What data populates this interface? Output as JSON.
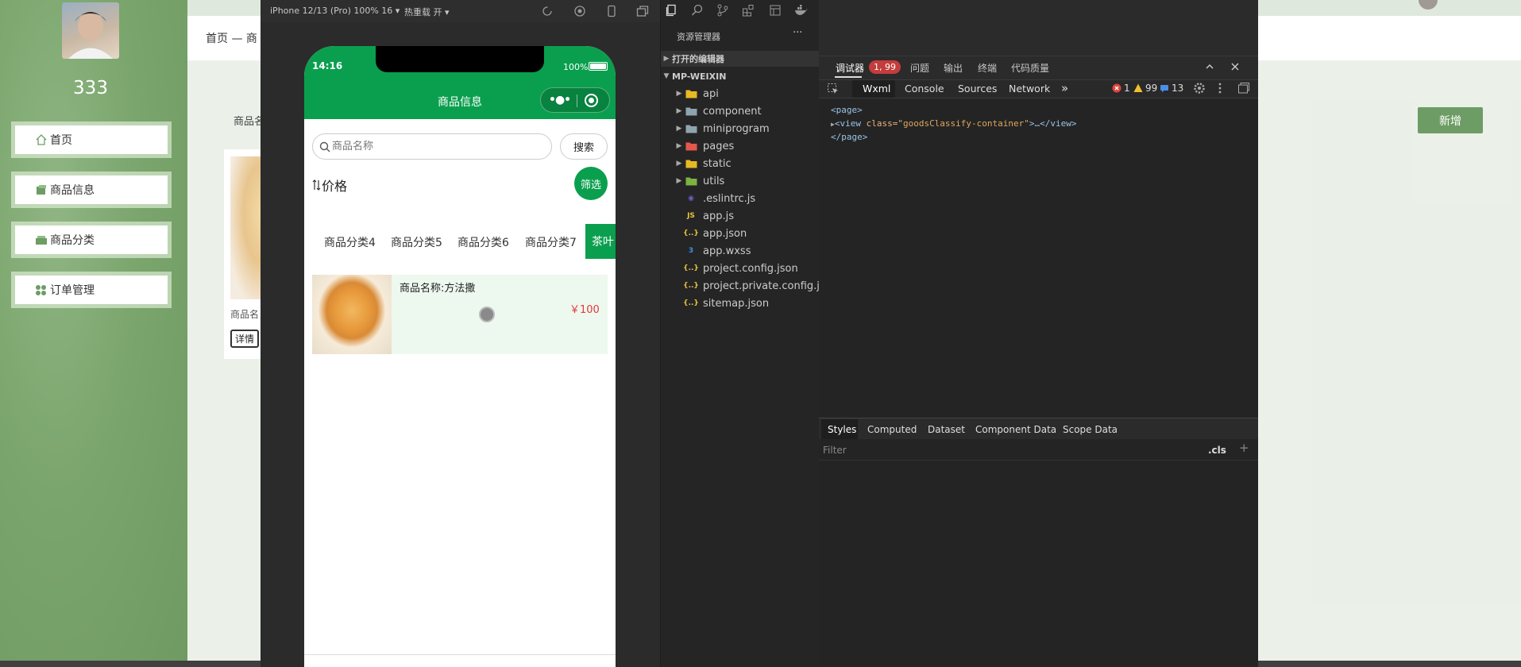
{
  "admin": {
    "username": "333",
    "menu": [
      {
        "label": "首页",
        "icon": "home-icon"
      },
      {
        "label": "商品信息",
        "icon": "goods-icon"
      },
      {
        "label": "商品分类",
        "icon": "category-icon"
      },
      {
        "label": "订单管理",
        "icon": "orders-icon"
      }
    ],
    "breadcrumb": "首页 — 商",
    "field_label": "商品名",
    "add_button": "新增",
    "card_label": "商品名",
    "card_detail_button": "详情"
  },
  "simulator": {
    "device_label": "iPhone 12/13 (Pro) 100% 16 ▾",
    "hot_reload_label": "热重载 开 ▾"
  },
  "phone": {
    "time": "14:16",
    "battery": "100%",
    "title": "商品信息",
    "search_placeholder": "商品名称",
    "search_button": "搜索",
    "sort_label": "价格",
    "filter_button": "筛选",
    "categories": [
      "商品分类4",
      "商品分类5",
      "商品分类6",
      "商品分类7"
    ],
    "active_category": "茶叶",
    "product": {
      "name": "商品名称:方法撒",
      "price": "￥100"
    }
  },
  "explorer": {
    "title": "资源管理器",
    "more": "···",
    "open_editors": "打开的编辑器",
    "project": "MP-WEIXIN",
    "folders": [
      {
        "name": "api",
        "icon": "api-folder-icon",
        "color": "#e8b923"
      },
      {
        "name": "component",
        "icon": "folder-icon",
        "color": "#90a4ae"
      },
      {
        "name": "miniprogram",
        "icon": "folder-icon",
        "color": "#90a4ae"
      },
      {
        "name": "pages",
        "icon": "pages-folder-icon",
        "color": "#e5574b"
      },
      {
        "name": "static",
        "icon": "static-folder-icon",
        "color": "#e8b923"
      },
      {
        "name": "utils",
        "icon": "utils-folder-icon",
        "color": "#7cb342"
      }
    ],
    "files": [
      {
        "name": ".eslintrc.js",
        "icon": "eslint-icon",
        "glyph": "◉",
        "color": "#6c5fc7"
      },
      {
        "name": "app.js",
        "icon": "js-file-icon",
        "glyph": "JS",
        "color": "#e8c43a"
      },
      {
        "name": "app.json",
        "icon": "json-file-icon",
        "glyph": "{..}",
        "color": "#e8c43a"
      },
      {
        "name": "app.wxss",
        "icon": "css-file-icon",
        "glyph": "3",
        "color": "#3b8fe8"
      },
      {
        "name": "project.config.json",
        "icon": "json-file-icon",
        "glyph": "{..}",
        "color": "#e8c43a"
      },
      {
        "name": "project.private.config.js...",
        "icon": "json-file-icon",
        "glyph": "{..}",
        "color": "#e8c43a"
      },
      {
        "name": "sitemap.json",
        "icon": "json-file-icon",
        "glyph": "{..}",
        "color": "#e8c43a"
      }
    ]
  },
  "debugger": {
    "tabs": [
      "调试器",
      "问题",
      "输出",
      "终端",
      "代码质量"
    ],
    "badge": "1, 99",
    "devtools_tabs": [
      "Wxml",
      "Console",
      "Sources",
      "Network",
      "»"
    ],
    "errors": "1",
    "warnings": "99",
    "infos": "13",
    "xml": {
      "page_open": "<page>",
      "view_open": "<view ",
      "attr_name": "class=",
      "attr_value": "\"goodsClassify-container\"",
      "view_rest": ">…</view>",
      "page_close": "</page>"
    },
    "styles_tabs": [
      "Styles",
      "Computed",
      "Dataset",
      "Component Data",
      "Scope Data"
    ],
    "filter_placeholder": "Filter",
    "cls": ".cls",
    "add": "+"
  }
}
